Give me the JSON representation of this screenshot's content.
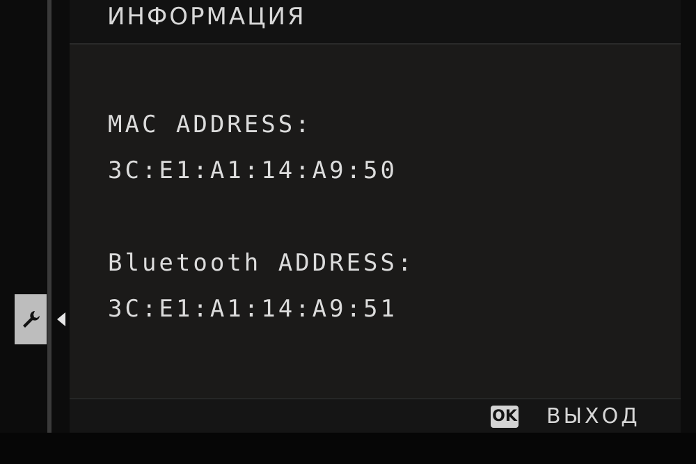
{
  "menu": {
    "title": "ИНФОРМАЦИЯ",
    "tab_icon": "wrench-icon",
    "tab_arrow_icon": "triangle-left-icon"
  },
  "info": {
    "mac_label": "MAC ADDRESS:",
    "mac_value": "3C:E1:A1:14:A9:50",
    "bluetooth_label": "Bluetooth ADDRESS:",
    "bluetooth_value": "3C:E1:A1:14:A9:51"
  },
  "footer": {
    "ok_button": "OK",
    "exit_label": "ВЫХОД"
  }
}
